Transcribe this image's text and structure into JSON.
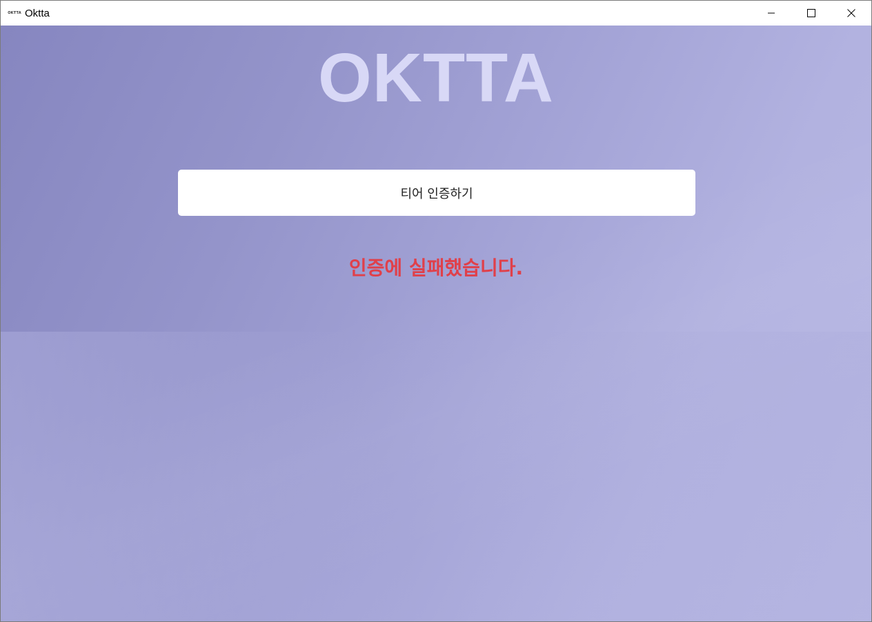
{
  "window": {
    "title": "Oktta",
    "icon_text": "OKTTA",
    "controls": {
      "minimize": "minimize-icon",
      "maximize": "maximize-icon",
      "close": "close-icon"
    }
  },
  "main": {
    "logo": "OKTTA",
    "verify_button_label": "티어 인증하기",
    "error_message": "인증에 실패했습니다."
  },
  "colors": {
    "logo": "#d8d8f6",
    "error": "#e0404a",
    "background_start": "#8686c0",
    "background_end": "#b8b8e4",
    "button": "#ffffff"
  }
}
